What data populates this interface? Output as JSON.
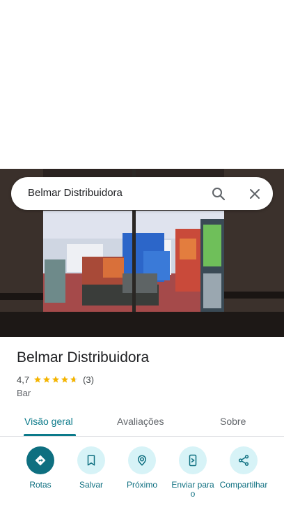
{
  "search": {
    "query": "Belmar Distribuidora"
  },
  "place": {
    "name": "Belmar Distribuidora",
    "rating": "4,7",
    "rating_stars": 4.7,
    "review_count": "(3)",
    "category": "Bar"
  },
  "tabs": [
    {
      "label": "Visão geral",
      "active": true
    },
    {
      "label": "Avaliações",
      "active": false
    },
    {
      "label": "Sobre",
      "active": false
    }
  ],
  "actions": [
    {
      "label": "Rotas",
      "icon": "directions-icon"
    },
    {
      "label": "Salvar",
      "icon": "bookmark-icon"
    },
    {
      "label": "Próximo",
      "icon": "nearby-icon"
    },
    {
      "label": "Enviar para o",
      "icon": "send-to-phone-icon"
    },
    {
      "label": "Compartilhar",
      "icon": "share-icon"
    }
  ],
  "colors": {
    "accent": "#0e6f80",
    "star": "#f4b400",
    "chip_bg": "#d7f3f7"
  }
}
